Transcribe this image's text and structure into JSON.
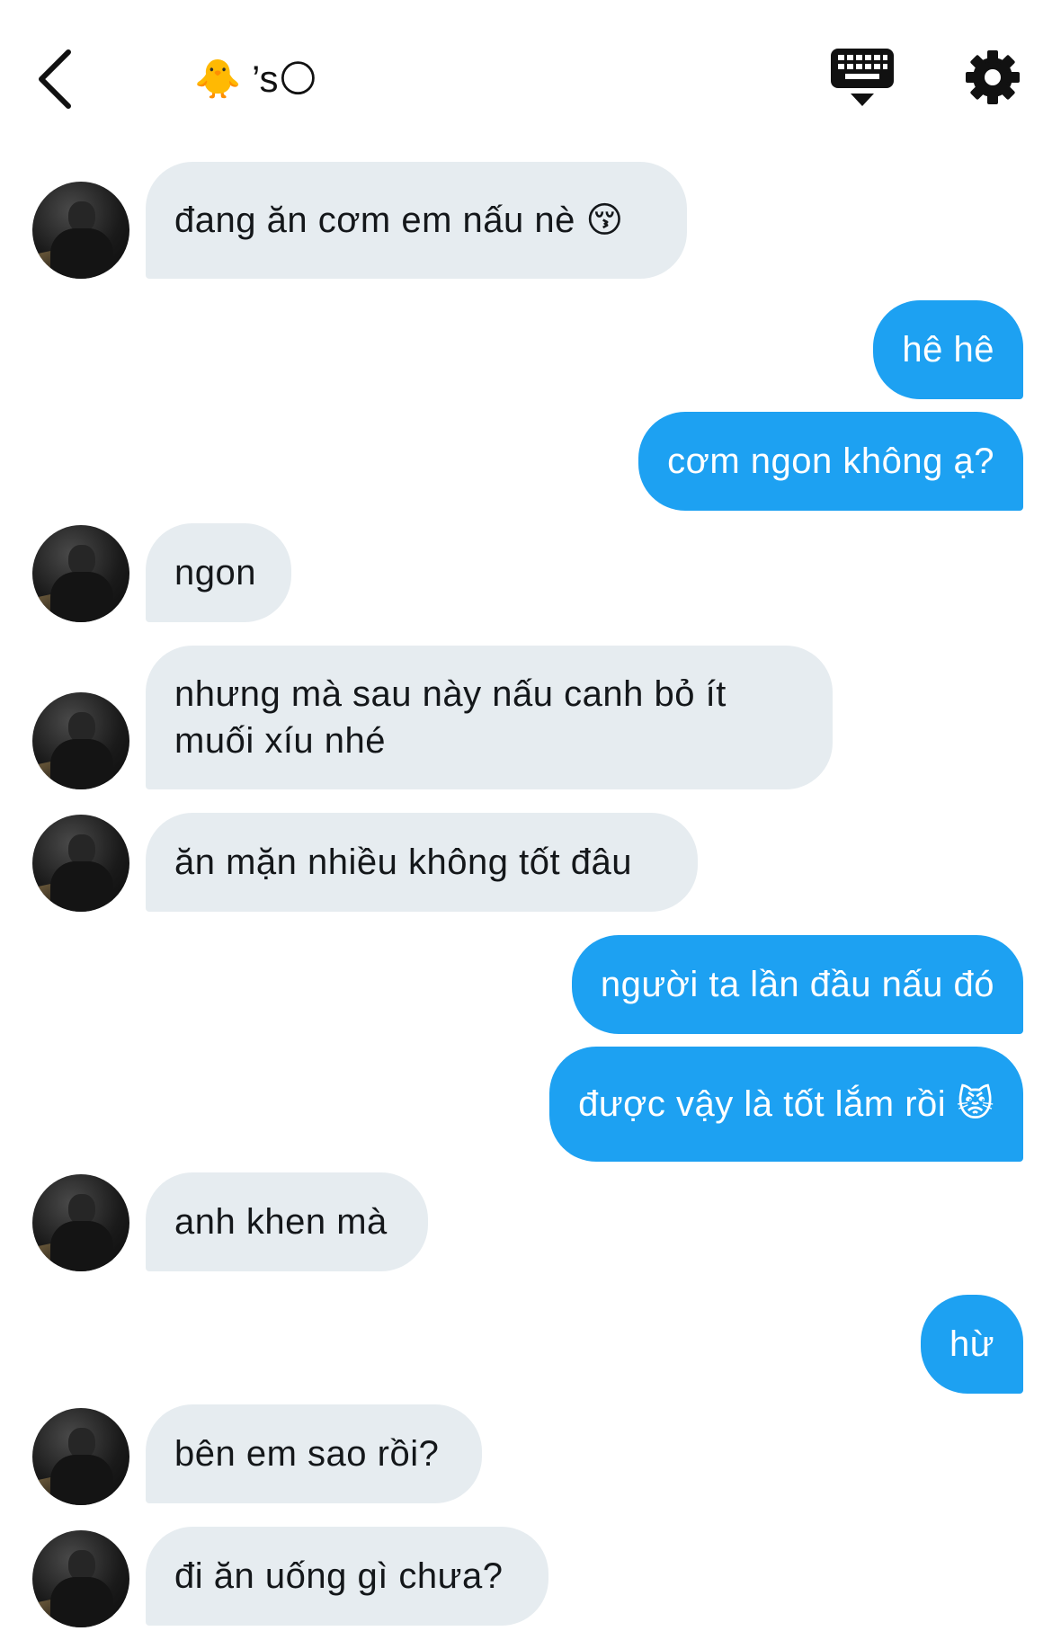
{
  "header": {
    "title": "🐥 ’s🌕",
    "back_icon": "chevron-left-icon",
    "keyboard_icon": "keyboard-icon",
    "settings_icon": "gear-icon"
  },
  "messages": [
    {
      "from": "them",
      "text": "đang ăn cơm em nấu nè 😚"
    },
    {
      "from": "me",
      "text": "hê hê"
    },
    {
      "from": "me",
      "text": "cơm ngon không ạ?"
    },
    {
      "from": "them",
      "text": "ngon"
    },
    {
      "from": "them",
      "text": "nhưng mà sau này nấu canh bỏ ít muối xíu nhé"
    },
    {
      "from": "them",
      "text": "ăn mặn nhiều không tốt đâu"
    },
    {
      "from": "me",
      "text": "người ta lần đầu nấu đó"
    },
    {
      "from": "me",
      "text": "được vậy là tốt lắm rồi 😾"
    },
    {
      "from": "them",
      "text": "anh khen mà"
    },
    {
      "from": "me",
      "text": "hừ"
    },
    {
      "from": "them",
      "text": "bên em sao rồi?"
    },
    {
      "from": "them",
      "text": "đi ăn uống gì chưa?"
    }
  ],
  "colors": {
    "incoming_bubble": "#e6ecf0",
    "outgoing_bubble": "#1da1f2",
    "incoming_text": "#14171a",
    "outgoing_text": "#ffffff"
  }
}
